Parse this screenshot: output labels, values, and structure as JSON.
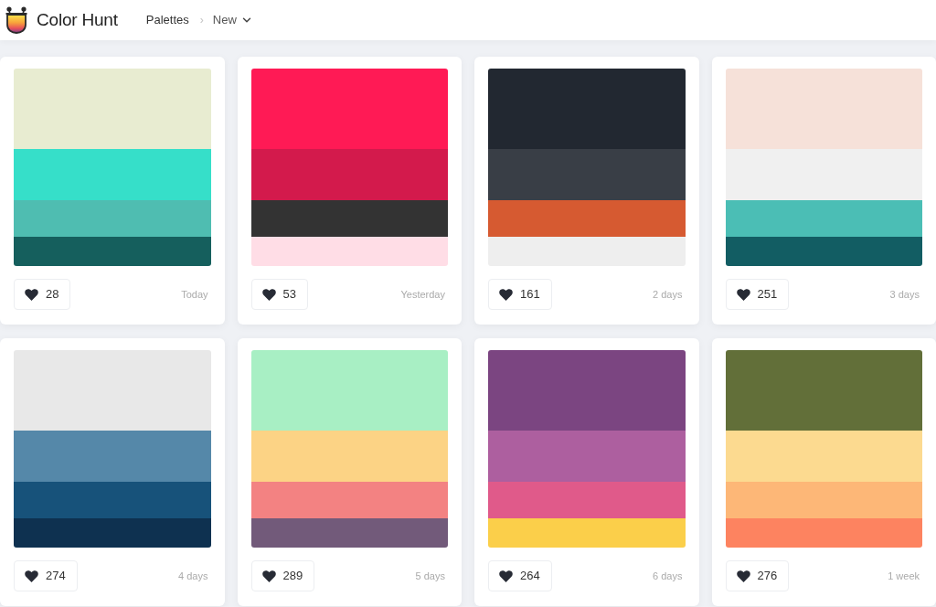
{
  "header": {
    "brand": "Color Hunt",
    "breadcrumb": {
      "root": "Palettes",
      "separator": "›",
      "current": "New"
    }
  },
  "palettes": [
    {
      "colors": [
        {
          "color": "#e8ecd1"
        },
        {
          "color": "#36dfc9"
        },
        {
          "color": "#4fbdb1"
        },
        {
          "color": "#155f5d"
        }
      ],
      "likes": "28",
      "date": "Today"
    },
    {
      "colors": [
        {
          "color": "#ff1a55"
        },
        {
          "color": "#d31a4c"
        },
        {
          "color": "#333333"
        },
        {
          "color": "#ffdde6"
        }
      ],
      "likes": "53",
      "date": "Yesterday"
    },
    {
      "colors": [
        {
          "color": "#222831"
        },
        {
          "color": "#393e46"
        },
        {
          "color": "#d65a31"
        },
        {
          "color": "#eeeeee"
        }
      ],
      "likes": "161",
      "date": "2 days"
    },
    {
      "colors": [
        {
          "color": "#f6e1d9"
        },
        {
          "color": "#f0f0f0"
        },
        {
          "color": "#4bbeb5"
        },
        {
          "color": "#125d63"
        }
      ],
      "likes": "251",
      "date": "3 days"
    },
    {
      "colors": [
        {
          "color": "#e8e8e8"
        },
        {
          "color": "#5588a9"
        },
        {
          "color": "#17527a"
        },
        {
          "color": "#0e3150"
        }
      ],
      "likes": "274",
      "date": "4 days"
    },
    {
      "colors": [
        {
          "color": "#a8efc4"
        },
        {
          "color": "#fcd385"
        },
        {
          "color": "#f38282"
        },
        {
          "color": "#725a7a"
        }
      ],
      "likes": "289",
      "date": "5 days"
    },
    {
      "colors": [
        {
          "color": "#7b4581"
        },
        {
          "color": "#ad5f9f"
        },
        {
          "color": "#e05a8a"
        },
        {
          "color": "#fbcf4a"
        }
      ],
      "likes": "264",
      "date": "6 days"
    },
    {
      "colors": [
        {
          "color": "#626f39"
        },
        {
          "color": "#fcda90"
        },
        {
          "color": "#fdb777"
        },
        {
          "color": "#fd8360"
        }
      ],
      "likes": "276",
      "date": "1 week"
    }
  ]
}
